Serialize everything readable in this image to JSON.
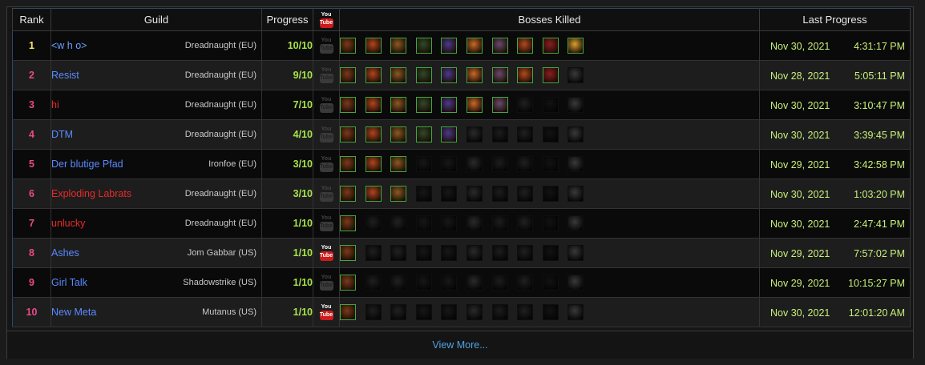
{
  "header": {
    "rank": "Rank",
    "guild": "Guild",
    "progress": "Progress",
    "youtube_icon": "youtube-icon",
    "bosses": "Bosses Killed",
    "last": "Last Progress"
  },
  "youtube": {
    "top": "You",
    "box": "Tube"
  },
  "boss_colors": [
    "#7a3a1a",
    "#b0461d",
    "#8a5a24",
    "#2e4a28",
    "#4a3a8a",
    "#c86a28",
    "#6a4a6a",
    "#b24a1e",
    "#8a1e1e",
    "#d8a030"
  ],
  "rows": [
    {
      "rank": "1",
      "rank_color": "#ffe066",
      "guild": "<w h o>",
      "guild_color": "#6aa0ff",
      "realm": "Dreadnaught (EU)",
      "progress": "10/10",
      "youtube": false,
      "killed": 10,
      "date": "Nov 30, 2021",
      "time": "4:31:17 PM"
    },
    {
      "rank": "2",
      "rank_color": "#e84a8a",
      "guild": "Resist",
      "guild_color": "#5a8aff",
      "realm": "Dreadnaught (EU)",
      "progress": "9/10",
      "youtube": false,
      "killed": 9,
      "date": "Nov 28, 2021",
      "time": "5:05:11 PM"
    },
    {
      "rank": "3",
      "rank_color": "#e84a8a",
      "guild": "hi",
      "guild_color": "#e82a2a",
      "realm": "Dreadnaught (EU)",
      "progress": "7/10",
      "youtube": false,
      "killed": 7,
      "date": "Nov 30, 2021",
      "time": "3:10:47 PM"
    },
    {
      "rank": "4",
      "rank_color": "#e84a8a",
      "guild": "DTM",
      "guild_color": "#5a8aff",
      "realm": "Dreadnaught (EU)",
      "progress": "4/10",
      "youtube": false,
      "killed": 5,
      "date": "Nov 30, 2021",
      "time": "3:39:45 PM"
    },
    {
      "rank": "5",
      "rank_color": "#e84a8a",
      "guild": "Der blutige Pfad",
      "guild_color": "#5a8aff",
      "realm": "Ironfoe (EU)",
      "progress": "3/10",
      "youtube": false,
      "killed": 3,
      "date": "Nov 29, 2021",
      "time": "3:42:58 PM"
    },
    {
      "rank": "6",
      "rank_color": "#e84a8a",
      "guild": "Exploding Labrats",
      "guild_color": "#e82a2a",
      "realm": "Dreadnaught (EU)",
      "progress": "3/10",
      "youtube": false,
      "killed": 3,
      "date": "Nov 30, 2021",
      "time": "1:03:20 PM"
    },
    {
      "rank": "7",
      "rank_color": "#e84a8a",
      "guild": "unlucky",
      "guild_color": "#e82a2a",
      "realm": "Dreadnaught (EU)",
      "progress": "1/10",
      "youtube": false,
      "killed": 1,
      "date": "Nov 30, 2021",
      "time": "2:47:41 PM"
    },
    {
      "rank": "8",
      "rank_color": "#e84a8a",
      "guild": "Ashes",
      "guild_color": "#5a8aff",
      "realm": "Jom Gabbar (US)",
      "progress": "1/10",
      "youtube": true,
      "killed": 1,
      "date": "Nov 29, 2021",
      "time": "7:57:02 PM"
    },
    {
      "rank": "9",
      "rank_color": "#e84a8a",
      "guild": "Girl Talk",
      "guild_color": "#5a8aff",
      "realm": "Shadowstrike (US)",
      "progress": "1/10",
      "youtube": false,
      "killed": 1,
      "date": "Nov 29, 2021",
      "time": "10:15:27 PM"
    },
    {
      "rank": "10",
      "rank_color": "#e84a8a",
      "guild": "New Meta",
      "guild_color": "#5a8aff",
      "realm": "Mutanus (US)",
      "progress": "1/10",
      "youtube": true,
      "killed": 1,
      "date": "Nov 30, 2021",
      "time": "12:01:20 AM"
    }
  ],
  "view_more": "View More..."
}
